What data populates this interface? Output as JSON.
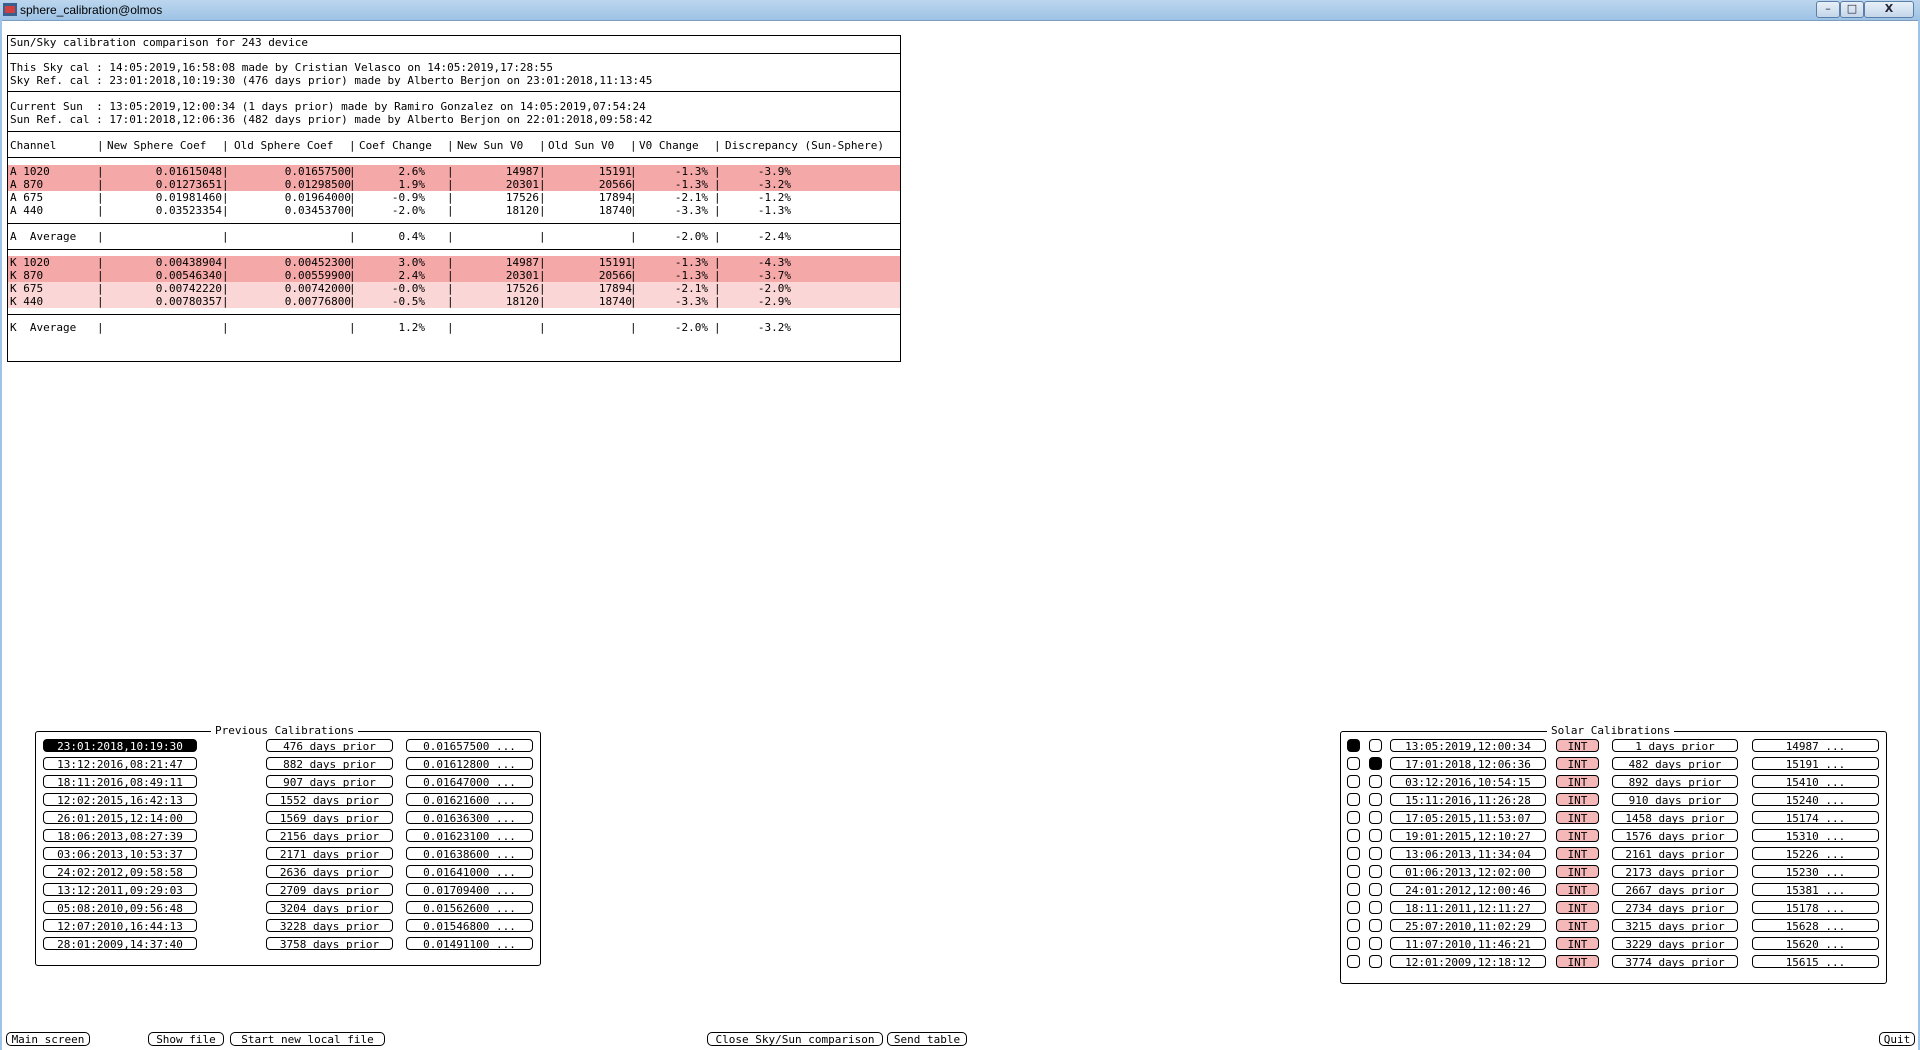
{
  "window": {
    "title": "sphere_calibration@olmos",
    "minimize": "–",
    "maximize": "□",
    "close": "X"
  },
  "report": {
    "heading": "Sun/Sky calibration comparison for 243 device",
    "sky_line1": "This Sky cal : 14:05:2019,16:58:08 made by Cristian Velasco on 14:05:2019,17:28:55",
    "sky_line2": "Sky Ref. cal : 23:01:2018,10:19:30 (476 days prior) made by Alberto Berjon on 23:01:2018,11:13:45",
    "sun_line1": "Current Sun  : 13:05:2019,12:00:34 (1 days prior) made by Ramiro Gonzalez on 14:05:2019,07:54:24",
    "sun_line2": "Sun Ref. cal : 17:01:2018,12:06:36 (482 days prior) made by Alberto Berjon on 22:01:2018,09:58:42",
    "columns": [
      "Channel",
      "New Sphere Coef",
      "Old Sphere Coef",
      "Coef Change",
      "New Sun V0",
      "Old Sun V0",
      "V0 Change",
      "Discrepancy (Sun-Sphere)"
    ],
    "separator": "|",
    "group_a": [
      {
        "channel": "A 1020",
        "new_coef": "0.01615048",
        "old_coef": "0.01657500",
        "coef_change": "2.6%",
        "new_v0": "14987",
        "old_v0": "15191",
        "v0_change": "-1.3%",
        "discrepancy": "-3.9%",
        "highlight": "strong"
      },
      {
        "channel": "A 870",
        "new_coef": "0.01273651",
        "old_coef": "0.01298500",
        "coef_change": "1.9%",
        "new_v0": "20301",
        "old_v0": "20566",
        "v0_change": "-1.3%",
        "discrepancy": "-3.2%",
        "highlight": "strong"
      },
      {
        "channel": "A 675",
        "new_coef": "0.01981460",
        "old_coef": "0.01964000",
        "coef_change": "-0.9%",
        "new_v0": "17526",
        "old_v0": "17894",
        "v0_change": "-2.1%",
        "discrepancy": "-1.2%",
        "highlight": "none"
      },
      {
        "channel": "A 440",
        "new_coef": "0.03523354",
        "old_coef": "0.03453700",
        "coef_change": "-2.0%",
        "new_v0": "18120",
        "old_v0": "18740",
        "v0_change": "-3.3%",
        "discrepancy": "-1.3%",
        "highlight": "none"
      }
    ],
    "group_a_avg": {
      "channel": "A  Average",
      "coef_change": "0.4%",
      "v0_change": "-2.0%",
      "discrepancy": "-2.4%"
    },
    "group_k": [
      {
        "channel": "K 1020",
        "new_coef": "0.00438904",
        "old_coef": "0.00452300",
        "coef_change": "3.0%",
        "new_v0": "14987",
        "old_v0": "15191",
        "v0_change": "-1.3%",
        "discrepancy": "-4.3%",
        "highlight": "strong"
      },
      {
        "channel": "K 870",
        "new_coef": "0.00546340",
        "old_coef": "0.00559900",
        "coef_change": "2.4%",
        "new_v0": "20301",
        "old_v0": "20566",
        "v0_change": "-1.3%",
        "discrepancy": "-3.7%",
        "highlight": "strong"
      },
      {
        "channel": "K 675",
        "new_coef": "0.00742220",
        "old_coef": "0.00742000",
        "coef_change": "-0.0%",
        "new_v0": "17526",
        "old_v0": "17894",
        "v0_change": "-2.1%",
        "discrepancy": "-2.0%",
        "highlight": "light"
      },
      {
        "channel": "K 440",
        "new_coef": "0.00780357",
        "old_coef": "0.00776800",
        "coef_change": "-0.5%",
        "new_v0": "18120",
        "old_v0": "18740",
        "v0_change": "-3.3%",
        "discrepancy": "-2.9%",
        "highlight": "light"
      }
    ],
    "group_k_avg": {
      "channel": "K  Average",
      "coef_change": "1.2%",
      "v0_change": "-2.0%",
      "discrepancy": "-3.2%"
    }
  },
  "previous": {
    "title": "Previous Calibrations",
    "rows": [
      {
        "date": "23:01:2018,10:19:30",
        "prior": "476 days prior",
        "coef": "0.01657500 ...",
        "selected": true
      },
      {
        "date": "13:12:2016,08:21:47",
        "prior": "882 days prior",
        "coef": "0.01612800 ...",
        "selected": false
      },
      {
        "date": "18:11:2016,08:49:11",
        "prior": "907 days prior",
        "coef": "0.01647000 ...",
        "selected": false
      },
      {
        "date": "12:02:2015,16:42:13",
        "prior": "1552 days prior",
        "coef": "0.01621600 ...",
        "selected": false
      },
      {
        "date": "26:01:2015,12:14:00",
        "prior": "1569 days prior",
        "coef": "0.01636300 ...",
        "selected": false
      },
      {
        "date": "18:06:2013,08:27:39",
        "prior": "2156 days prior",
        "coef": "0.01623100 ...",
        "selected": false
      },
      {
        "date": "03:06:2013,10:53:37",
        "prior": "2171 days prior",
        "coef": "0.01638600 ...",
        "selected": false
      },
      {
        "date": "24:02:2012,09:58:58",
        "prior": "2636 days prior",
        "coef": "0.01641000 ...",
        "selected": false
      },
      {
        "date": "13:12:2011,09:29:03",
        "prior": "2709 days prior",
        "coef": "0.01709400 ...",
        "selected": false
      },
      {
        "date": "05:08:2010,09:56:48",
        "prior": "3204 days prior",
        "coef": "0.01562600 ...",
        "selected": false
      },
      {
        "date": "12:07:2010,16:44:13",
        "prior": "3228 days prior",
        "coef": "0.01546800 ...",
        "selected": false
      },
      {
        "date": "28:01:2009,14:37:40",
        "prior": "3758 days prior",
        "coef": "0.01491100 ...",
        "selected": false
      }
    ]
  },
  "solar": {
    "title": "Solar Calibrations",
    "rows": [
      {
        "c1": true,
        "c2": false,
        "date": "13:05:2019,12:00:34",
        "tag": "INT",
        "prior": "1 days prior",
        "v0": "14987 ..."
      },
      {
        "c1": false,
        "c2": true,
        "date": "17:01:2018,12:06:36",
        "tag": "INT",
        "prior": "482 days prior",
        "v0": "15191 ..."
      },
      {
        "c1": false,
        "c2": false,
        "date": "03:12:2016,10:54:15",
        "tag": "INT",
        "prior": "892 days prior",
        "v0": "15410 ..."
      },
      {
        "c1": false,
        "c2": false,
        "date": "15:11:2016,11:26:28",
        "tag": "INT",
        "prior": "910 days prior",
        "v0": "15240 ..."
      },
      {
        "c1": false,
        "c2": false,
        "date": "17:05:2015,11:53:07",
        "tag": "INT",
        "prior": "1458 days prior",
        "v0": "15174 ..."
      },
      {
        "c1": false,
        "c2": false,
        "date": "19:01:2015,12:10:27",
        "tag": "INT",
        "prior": "1576 days prior",
        "v0": "15310 ..."
      },
      {
        "c1": false,
        "c2": false,
        "date": "13:06:2013,11:34:04",
        "tag": "INT",
        "prior": "2161 days prior",
        "v0": "15226 ..."
      },
      {
        "c1": false,
        "c2": false,
        "date": "01:06:2013,12:02:00",
        "tag": "INT",
        "prior": "2173 days prior",
        "v0": "15230 ..."
      },
      {
        "c1": false,
        "c2": false,
        "date": "24:01:2012,12:00:46",
        "tag": "INT",
        "prior": "2667 days prior",
        "v0": "15381 ..."
      },
      {
        "c1": false,
        "c2": false,
        "date": "18:11:2011,12:11:27",
        "tag": "INT",
        "prior": "2734 days prior",
        "v0": "15178 ..."
      },
      {
        "c1": false,
        "c2": false,
        "date": "25:07:2010,11:02:29",
        "tag": "INT",
        "prior": "3215 days prior",
        "v0": "15628 ..."
      },
      {
        "c1": false,
        "c2": false,
        "date": "11:07:2010,11:46:21",
        "tag": "INT",
        "prior": "3229 days prior",
        "v0": "15620 ..."
      },
      {
        "c1": false,
        "c2": false,
        "date": "12:01:2009,12:18:12",
        "tag": "INT",
        "prior": "3774 days prior",
        "v0": "15615 ..."
      }
    ]
  },
  "buttons": {
    "main_screen": "Main screen",
    "show_file": "Show file",
    "start_new_local_file": "Start new local file",
    "close_comparison": "Close Sky/Sun comparison",
    "send_table": "Send table",
    "quit": "Quit"
  },
  "colors": {
    "highlight_strong": "#f4a8a8",
    "highlight_light": "#fbd6d6",
    "int_badge": "#f5b8b8",
    "titlebar": "#9ec3e6"
  }
}
